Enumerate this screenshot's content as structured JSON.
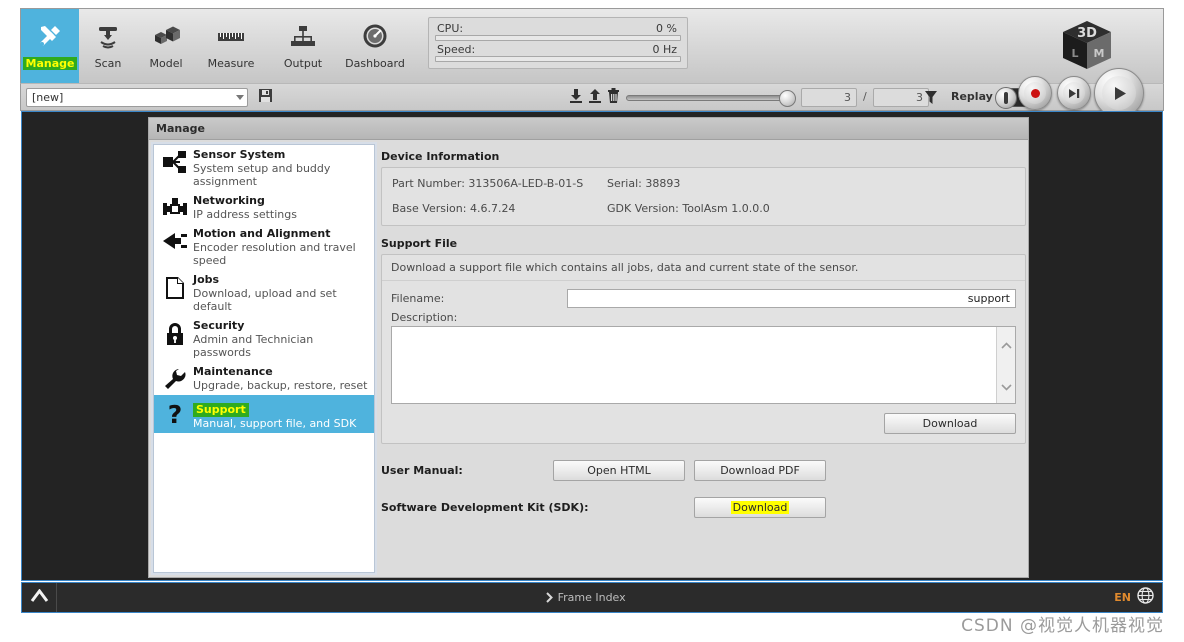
{
  "toolbar": {
    "tabs": [
      {
        "label": "Manage",
        "icon": "tools-icon",
        "active": true
      },
      {
        "label": "Scan",
        "icon": "scanner-icon",
        "active": false
      },
      {
        "label": "Model",
        "icon": "cubes-icon",
        "active": false
      },
      {
        "label": "Measure",
        "icon": "ruler-icon",
        "active": false
      },
      {
        "label": "Output",
        "icon": "network-tree-icon",
        "active": false
      },
      {
        "label": "Dashboard",
        "icon": "gauge-icon",
        "active": false
      }
    ],
    "gauges": [
      {
        "label": "CPU:",
        "value": "0 %",
        "percent": 0
      },
      {
        "label": "Speed:",
        "value": "0 Hz",
        "percent": 0
      }
    ],
    "logo_alt": "lmi-3d-cube-logo"
  },
  "secondbar": {
    "job_value": "[new]",
    "save_icon": "floppy-save-icon",
    "mini_icons": [
      "download-icon",
      "upload-icon",
      "trash-icon"
    ],
    "frame_current": "3",
    "frame_total": "3",
    "separator": "/",
    "filter_icon": "funnel-icon",
    "replay_label": "Replay",
    "record_icon": "record-icon",
    "step_icon": "step-forward-icon",
    "play_icon": "play-icon"
  },
  "panel": {
    "title": "Manage",
    "nav_items": [
      {
        "title": "Sensor System",
        "subtitle": "System setup and buddy assignment",
        "icon": "share-nodes-icon",
        "selected": false
      },
      {
        "title": "Networking",
        "subtitle": "IP address settings",
        "icon": "network-plug-icon",
        "selected": false
      },
      {
        "title": "Motion and Alignment",
        "subtitle": "Encoder resolution and travel speed",
        "icon": "arrow-left-plug-icon",
        "selected": false
      },
      {
        "title": "Jobs",
        "subtitle": "Download, upload and set default",
        "icon": "document-icon",
        "selected": false
      },
      {
        "title": "Security",
        "subtitle": "Admin and Technician passwords",
        "icon": "lock-icon",
        "selected": false
      },
      {
        "title": "Maintenance",
        "subtitle": "Upgrade, backup, restore, reset",
        "icon": "wrench-icon",
        "selected": false
      },
      {
        "title": "Support",
        "subtitle": "Manual, support file, and SDK",
        "icon": "question-mark-icon",
        "selected": true
      }
    ],
    "device_information": {
      "heading": "Device Information",
      "part_number_label": "Part Number:",
      "part_number_value": "313506A-LED-B-01-S",
      "serial_label": "Serial:",
      "serial_value": "38893",
      "base_version_label": "Base Version:",
      "base_version_value": "4.6.7.24",
      "gdk_version_label": "GDK Version:",
      "gdk_version_value": "ToolAsm 1.0.0.0"
    },
    "support_file": {
      "heading": "Support File",
      "description_text": "Download a support file which contains all jobs, data and current state of the sensor.",
      "filename_label": "Filename:",
      "filename_value": "support",
      "description_label": "Description:",
      "description_value": "",
      "download_button": "Download",
      "scroll_up_icon": "chevron-up-icon",
      "scroll_down_icon": "chevron-down-icon"
    },
    "user_manual": {
      "label": "User Manual:",
      "open_html_button": "Open HTML",
      "download_pdf_button": "Download PDF"
    },
    "sdk": {
      "label": "Software Development Kit (SDK):",
      "download_button": "Download",
      "highlighted": true
    }
  },
  "statusbar": {
    "caret_icon": "chevron-up-icon",
    "frame_index_label": "Frame Index",
    "frame_index_icon": "chevron-right-icon",
    "language": "EN",
    "globe_icon": "globe-icon"
  },
  "watermark": "CSDN @视觉人机器视觉",
  "colors": {
    "accent_blue": "#4fb3dd",
    "highlight_green": "#2fab1f",
    "highlight_yellow": "#ffff00",
    "border_blue": "#3a86c8",
    "canvas_dark": "#232323",
    "lang_orange": "#e08a2e"
  }
}
